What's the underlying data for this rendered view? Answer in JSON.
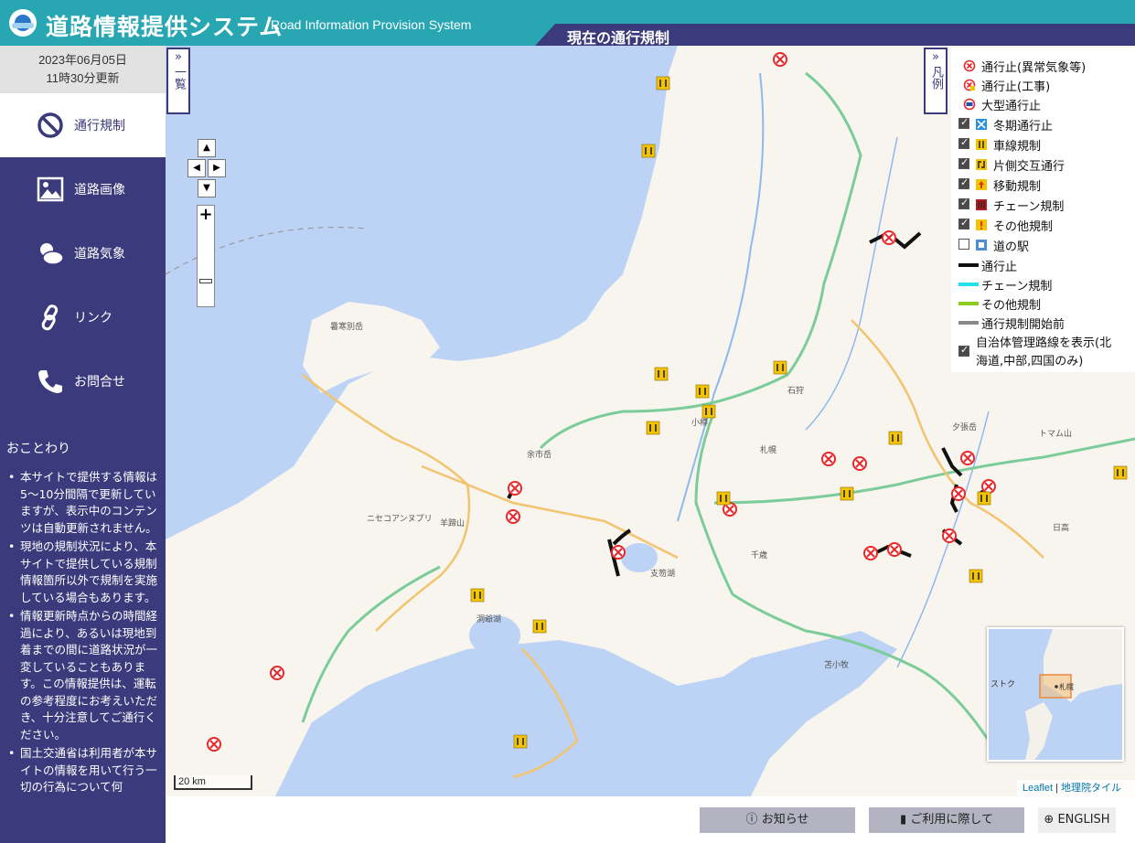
{
  "header": {
    "title_ja": "道路情報提供システム",
    "title_en": "Road Information Provision System",
    "banner": "現在の通行規制"
  },
  "sidebar": {
    "updated_date": "2023年06月05日",
    "updated_time": "11時30分更新",
    "nav": [
      {
        "label": "通行規制",
        "icon": "no-entry-icon",
        "active": true
      },
      {
        "label": "道路画像",
        "icon": "image-icon",
        "active": false
      },
      {
        "label": "道路気象",
        "icon": "weather-icon",
        "active": false
      },
      {
        "label": "リンク",
        "icon": "link-icon",
        "active": false
      },
      {
        "label": "お問合せ",
        "icon": "phone-icon",
        "active": false
      }
    ],
    "notice_title": "おことわり",
    "notices": [
      "本サイトで提供する情報は5～10分間隔で更新していますが、表示中のコンテンツは自動更新されません。",
      "現地の規制状況により、本サイトで提供している規制情報箇所以外で規制を実施している場合もあります。",
      "情報更新時点からの時間経過により、あるいは現地到着までの間に道路状況が一変していることもあります。この情報提供は、運転の参考程度にお考えいただき、十分注意してご通行ください。",
      "国土交通省は利用者が本サイトの情報を用いて行う一切の行為について何"
    ]
  },
  "map": {
    "list_tab": "一覧",
    "legend_tab": "凡例",
    "scale_label": "20 km",
    "attribution_leaflet": "Leaflet",
    "attribution_sep": "|",
    "attribution_tiles": "地理院タイル",
    "minimap_label_1": "ストク",
    "minimap_label_2": "札幌",
    "places": [
      {
        "name": "小樽"
      },
      {
        "name": "札幌"
      },
      {
        "name": "石狩"
      },
      {
        "name": "千歳"
      },
      {
        "name": "余市岳"
      },
      {
        "name": "羊蹄山"
      },
      {
        "name": "洞爺湖"
      },
      {
        "name": "支笏湖"
      },
      {
        "name": "ニセコアンヌプリ"
      },
      {
        "name": "夕張岳"
      },
      {
        "name": "トマム山"
      },
      {
        "name": "日高"
      },
      {
        "name": "苫小牧"
      },
      {
        "name": "暑寒別岳"
      }
    ]
  },
  "legend": {
    "items": [
      {
        "label": "通行止(異常気象等)",
        "checkbox": null,
        "icon": "closure-weather-icon"
      },
      {
        "label": "通行止(工事)",
        "checkbox": null,
        "icon": "closure-construction-icon"
      },
      {
        "label": "大型通行止",
        "checkbox": null,
        "icon": "large-vehicle-closure-icon"
      },
      {
        "label": "冬期通行止",
        "checkbox": true,
        "icon": "winter-closure-icon"
      },
      {
        "label": "車線規制",
        "checkbox": true,
        "icon": "lane-restriction-icon"
      },
      {
        "label": "片側交互通行",
        "checkbox": true,
        "icon": "alternating-traffic-icon"
      },
      {
        "label": "移動規制",
        "checkbox": true,
        "icon": "mobile-restriction-icon"
      },
      {
        "label": "チェーン規制",
        "checkbox": true,
        "icon": "chain-restriction-icon"
      },
      {
        "label": "その他規制",
        "checkbox": true,
        "icon": "other-restriction-icon"
      },
      {
        "label": "道の駅",
        "checkbox": false,
        "icon": "roadside-station-icon"
      },
      {
        "label": "通行止",
        "checkbox": null,
        "icon": "closure-line-icon"
      },
      {
        "label": "チェーン規制",
        "checkbox": null,
        "icon": "chain-line-icon"
      },
      {
        "label": "その他規制",
        "checkbox": null,
        "icon": "other-line-icon"
      },
      {
        "label": "通行規制開始前",
        "checkbox": null,
        "icon": "pre-restriction-line-icon"
      }
    ],
    "municipal_line1": "自治体管理路線を表示(北",
    "municipal_line2": "海道,中部,四国のみ)"
  },
  "footer": {
    "notice_btn": "お知らせ",
    "usage_btn": "ご利用に際して",
    "lang_btn": "ENGLISH"
  },
  "colors": {
    "header": "#28a7b3",
    "sidebar": "#3a3a7c",
    "sea": "#bcd3f5",
    "closure_red": "#e8292c",
    "construction_yellow": "#f5c400"
  }
}
